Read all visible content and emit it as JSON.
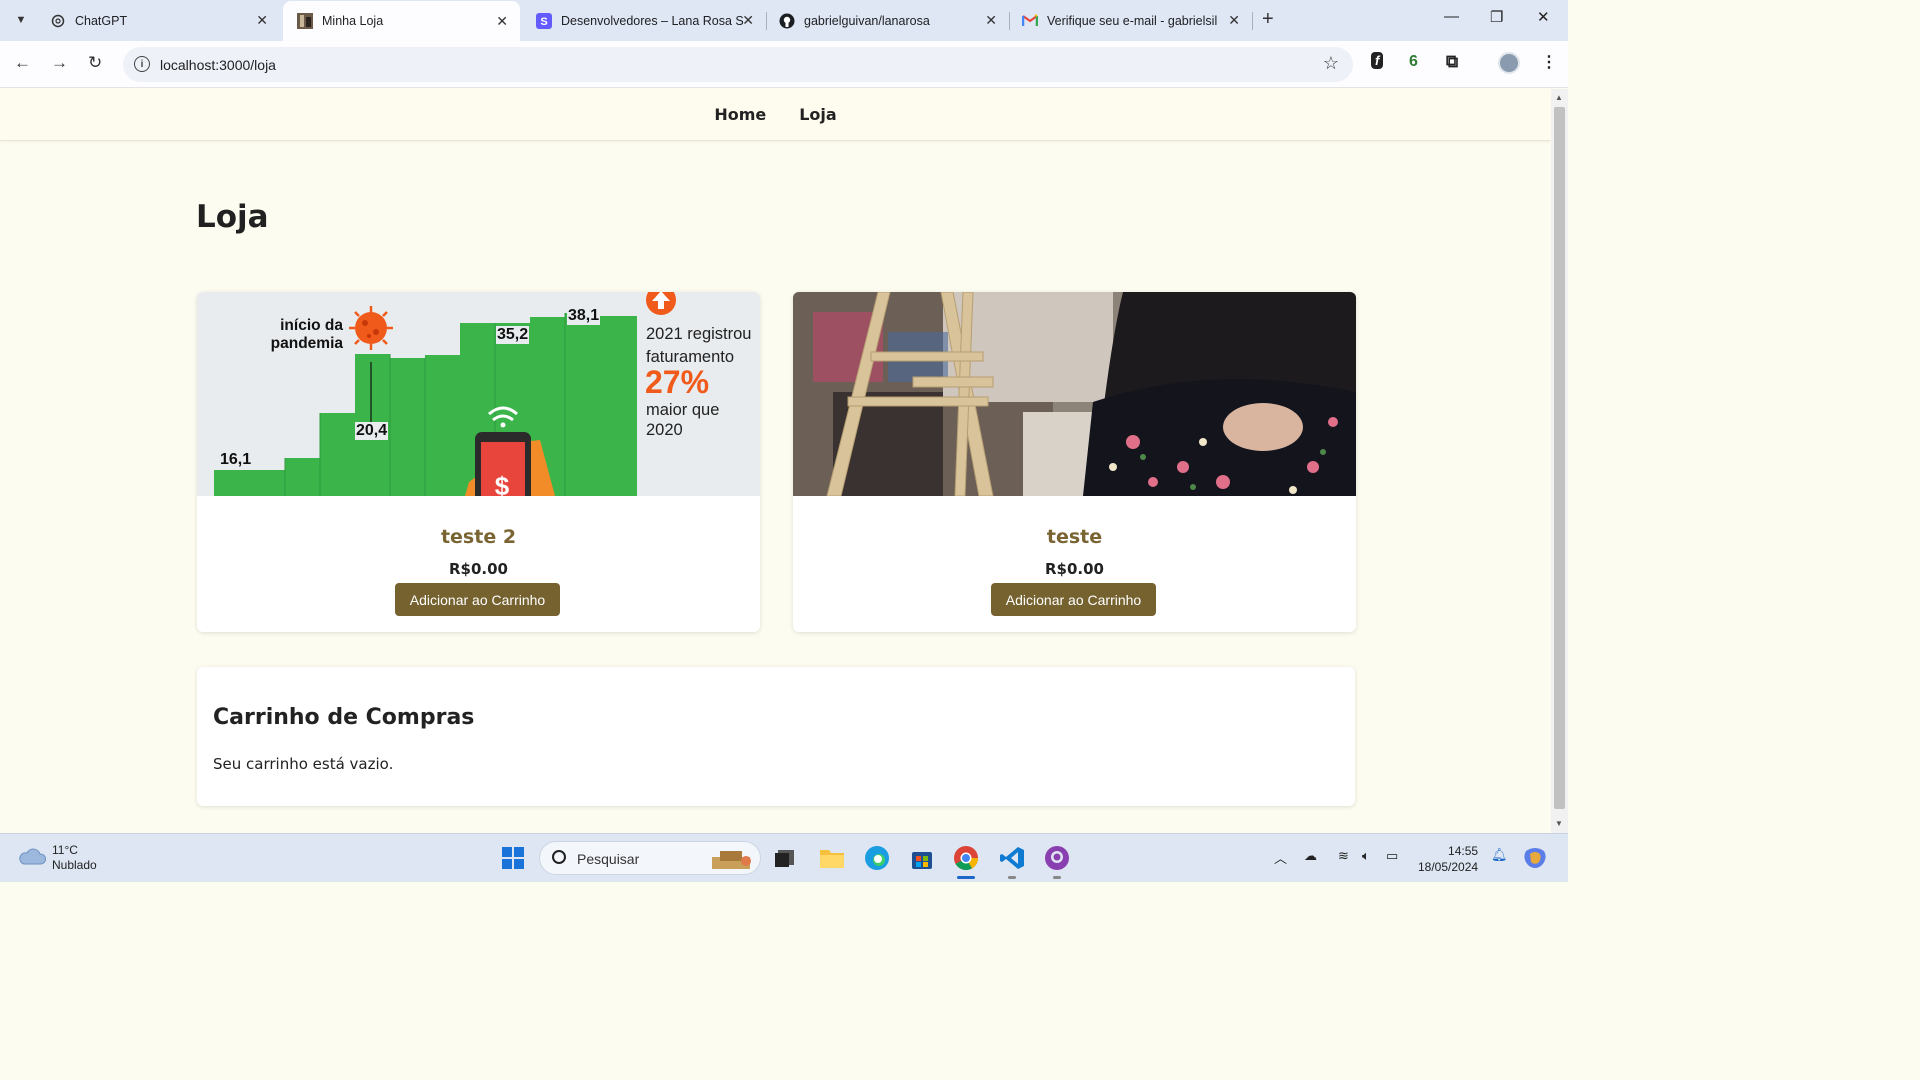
{
  "browser": {
    "tabs": [
      {
        "title": "ChatGPT",
        "active": false,
        "icon": "chatgpt-icon"
      },
      {
        "title": "Minha Loja",
        "active": true,
        "icon": "site-favicon"
      },
      {
        "title": "Desenvolvedores – Lana Rosa S",
        "active": false,
        "icon": "stripe-icon"
      },
      {
        "title": "gabrielguivan/lanarosa",
        "active": false,
        "icon": "github-icon"
      },
      {
        "title": "Verifique seu e-mail - gabrielsil",
        "active": false,
        "icon": "gmail-icon"
      }
    ],
    "url": "localhost:3000/loja",
    "extension_badge": "6"
  },
  "site": {
    "nav": [
      "Home",
      "Loja"
    ],
    "page_title": "Loja",
    "products": [
      {
        "name": "teste 2",
        "price": "R$0.00",
        "button": "Adicionar ao Carrinho",
        "image": {
          "type": "infographic",
          "bar_values": [
            "16,1",
            "20,4",
            "35,2",
            "38,1"
          ],
          "pandemic_label": "início da pandemia",
          "text_line1": "2021 registrou",
          "text_line2": "faturamento",
          "percent": "27%",
          "text_line3": "maior que",
          "text_line4": "2020"
        }
      },
      {
        "name": "teste",
        "price": "R$0.00",
        "button": "Adicionar ao Carrinho",
        "image": {
          "type": "photo"
        }
      }
    ],
    "cart": {
      "title": "Carrinho de Compras",
      "empty_message": "Seu carrinho está vazio."
    }
  },
  "taskbar": {
    "weather_temp": "11°C",
    "weather_desc": "Nublado",
    "search_placeholder": "Pesquisar",
    "time": "14:55",
    "date": "18/05/2024"
  },
  "colors": {
    "page_bg": "#fdfcf0",
    "button_bg": "#76622f",
    "product_name": "#7a6432",
    "chart_green": "#3bb54a",
    "chart_orange": "#f05a1a"
  }
}
